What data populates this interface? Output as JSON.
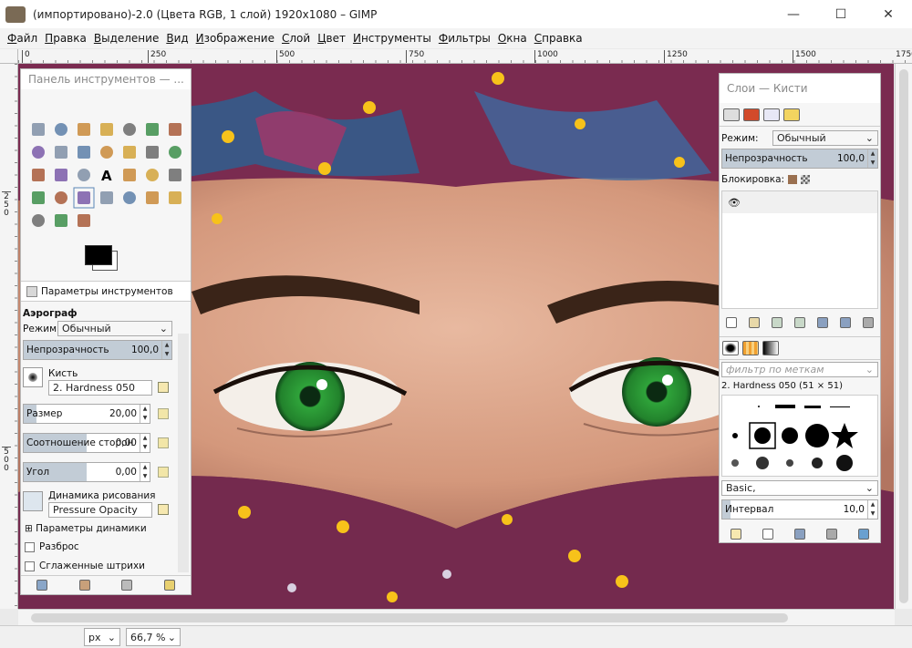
{
  "window": {
    "title": "(импортировано)-2.0 (Цвета RGB, 1 слой) 1920x1080 – GIMP",
    "minimize": "—",
    "maximize": "☐",
    "close": "✕"
  },
  "menu": [
    "Файл",
    "Правка",
    "Выделение",
    "Вид",
    "Изображение",
    "Слой",
    "Цвет",
    "Инструменты",
    "Фильтры",
    "Окна",
    "Справка"
  ],
  "ruler": {
    "h_labels": [
      "0",
      "250",
      "500",
      "750",
      "1000",
      "1250",
      "1500",
      "1750"
    ],
    "v_labels": [
      "2 5 0",
      "5 0 0"
    ]
  },
  "toolbox": {
    "title": "Панель инструментов — ...",
    "tools": [
      "rect-select",
      "ellipse-select",
      "lasso",
      "fuzzy-select",
      "by-color-select",
      "scissors",
      "color-picker",
      "zoom",
      "measure",
      "move",
      "align",
      "warp",
      "crop",
      "rotate",
      "scale",
      "shear",
      "perspective",
      "text",
      "paths",
      "gradient",
      "pencil",
      "paintbrush",
      "eraser",
      "airbrush",
      "ink",
      "clone",
      "heal",
      "smudge",
      "dodge",
      "bucket-fill",
      "blur"
    ],
    "fg_color": "#000000",
    "bg_color": "#ffffff"
  },
  "tool_options": {
    "tab_label": "Параметры инструментов",
    "tool_name": "Аэрограф",
    "mode_label": "Режим:",
    "mode_value": "Обычный",
    "opacity": {
      "label": "Непрозрачность",
      "value": "100,0",
      "fraction": 1.0
    },
    "brush_label": "Кисть",
    "brush_value": "2. Hardness 050",
    "size": {
      "label": "Размер",
      "value": "20,00",
      "fraction": 0.1
    },
    "aspect": {
      "label": "Соотношение сторон",
      "value": "0,00",
      "fraction": 0.5
    },
    "angle": {
      "label": "Угол",
      "value": "0,00",
      "fraction": 0.5
    },
    "dynamics_label": "Динамика рисования",
    "dynamics_value": "Pressure Opacity",
    "dynamics_options": "Параметры динамики",
    "scatter": "Разброс",
    "smooth": "Сглаженные штрихи"
  },
  "layers": {
    "title": "Слои — Кисти",
    "mode_label": "Режим:",
    "mode_value": "Обычный",
    "opacity_label": "Непрозрачность",
    "opacity_value": "100,0",
    "lock_label": "Блокировка:"
  },
  "brushes": {
    "filter_placeholder": "фильтр по меткам",
    "selected": "2. Hardness 050 (51 × 51)",
    "preset": "Basic,",
    "spacing_label": "Интервал",
    "spacing_value": "10,0"
  },
  "status": {
    "unit": "px",
    "zoom": "66,7 %"
  },
  "colors": {
    "accent": "#c2ccd6",
    "scarf": "#6b2a48",
    "eye": "#2f9a38"
  }
}
